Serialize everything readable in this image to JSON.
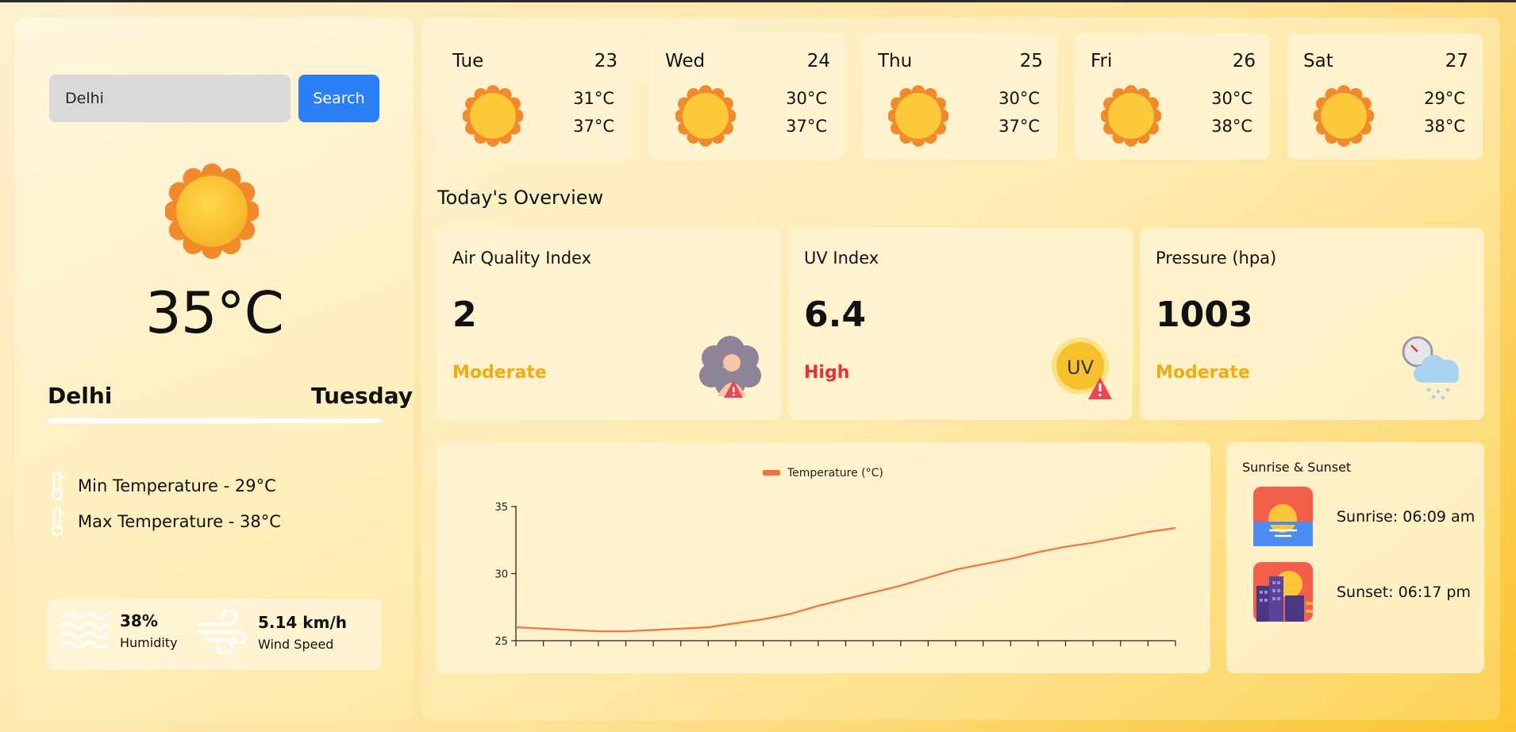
{
  "search": {
    "value": "Delhi",
    "button_label": "Search"
  },
  "current": {
    "temperature": "35°C",
    "city": "Delhi",
    "day": "Tuesday",
    "min_temp_label": "Min Temperature - 29°C",
    "max_temp_label": "Max Temperature - 38°C",
    "humidity_value": "38%",
    "humidity_label": "Humidity",
    "wind_value": "5.14 km/h",
    "wind_label": "Wind Speed"
  },
  "forecast": [
    {
      "day": "Tue",
      "date": "23",
      "min": "31°C",
      "max": "37°C"
    },
    {
      "day": "Wed",
      "date": "24",
      "min": "30°C",
      "max": "37°C"
    },
    {
      "day": "Thu",
      "date": "25",
      "min": "30°C",
      "max": "37°C"
    },
    {
      "day": "Fri",
      "date": "26",
      "min": "30°C",
      "max": "38°C"
    },
    {
      "day": "Sat",
      "date": "27",
      "min": "29°C",
      "max": "38°C"
    }
  ],
  "overview": {
    "title": "Today's Overview",
    "cards": [
      {
        "title": "Air Quality Index",
        "value": "2",
        "status": "Moderate",
        "status_color": "#f0ac10",
        "icon": "air-pollution-icon"
      },
      {
        "title": "UV Index",
        "value": "6.4",
        "status": "High",
        "status_color": "#e8303a",
        "icon": "uv-warning-icon",
        "icon_text": "UV"
      },
      {
        "title": "Pressure (hpa)",
        "value": "1003",
        "status": "Moderate",
        "status_color": "#f0ac10",
        "icon": "pressure-cloud-icon"
      }
    ]
  },
  "chart_data": {
    "type": "line",
    "series": [
      {
        "name": "Temperature (°C)",
        "color": "#f4703f",
        "values": [
          26.0,
          25.9,
          25.8,
          25.7,
          25.7,
          25.8,
          25.9,
          26.0,
          26.3,
          26.6,
          27.0,
          27.6,
          28.1,
          28.6,
          29.1,
          29.7,
          30.3,
          30.7,
          31.1,
          31.6,
          32.0,
          32.3,
          32.7,
          33.1,
          33.4
        ]
      }
    ],
    "ylim": [
      25,
      35
    ],
    "yticks": [
      "25",
      "30",
      "35"
    ],
    "x_tick_count": 24,
    "grid": false,
    "legend_position": "top"
  },
  "sun": {
    "title": "Sunrise & Sunset",
    "sunrise": "Sunrise: 06:09 am",
    "sunset": "Sunset: 06:17 pm"
  },
  "colors": {
    "search_button": "#2a7ff6",
    "accent_line": "#f4703f"
  }
}
